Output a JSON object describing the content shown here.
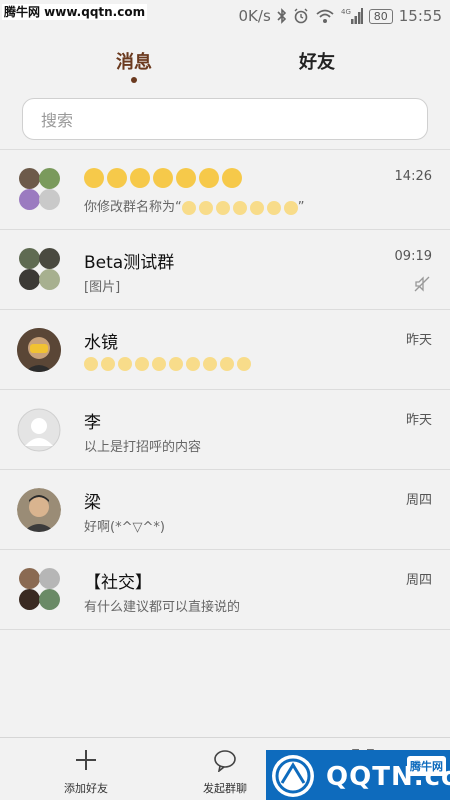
{
  "watermark": "腾牛网 www.qqtn.com",
  "status": {
    "speed": "0K/s",
    "time": "15:55",
    "battery": "80",
    "network": "4G"
  },
  "tabs": [
    {
      "label": "消息",
      "active": true
    },
    {
      "label": "好友",
      "active": false
    }
  ],
  "search": {
    "placeholder": "搜索"
  },
  "conversations": [
    {
      "name": "",
      "preview_prefix": "你修改群名称为“",
      "preview_suffix": "”",
      "time": "14:26",
      "type": "group",
      "muted": false
    },
    {
      "name": "Beta测试群",
      "preview": "[图片]",
      "time": "09:19",
      "type": "group",
      "muted": true
    },
    {
      "name": "水镜",
      "preview": "",
      "time": "昨天",
      "type": "person",
      "muted": false
    },
    {
      "name": "李",
      "preview": "以上是打招呼的内容",
      "time": "昨天",
      "type": "default",
      "muted": false
    },
    {
      "name": "梁",
      "preview": "好啊(*^▽^*)",
      "time": "周四",
      "type": "person",
      "muted": false
    },
    {
      "name": "【社交】",
      "preview": "有什么建议都可以直接说的",
      "time": "周四",
      "type": "group",
      "muted": false
    }
  ],
  "bottom_bar": [
    {
      "label": "添加好友",
      "icon": "plus-icon"
    },
    {
      "label": "发起群聊",
      "icon": "chat-bubble-icon"
    },
    {
      "label": "",
      "icon": "scan-icon"
    }
  ],
  "logo": {
    "text": "QQTN.com",
    "tag": "腾牛网"
  },
  "colors": {
    "accent": "#6b3a1f",
    "background": "#f2f2f2",
    "logo_blue": "#0e6bbd"
  }
}
